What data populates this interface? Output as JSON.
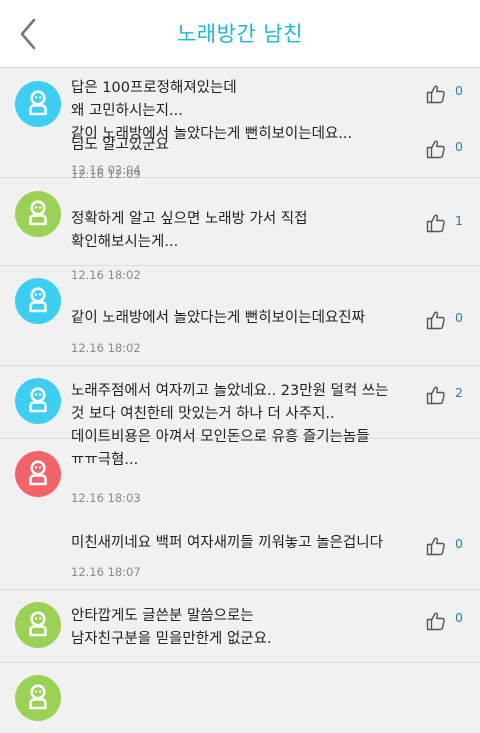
{
  "header": {
    "title": "노래방간 남친"
  },
  "colors": {
    "blue": "#3dcff2",
    "green": "#9bd155",
    "red": "#f2636a"
  },
  "comments": [
    {
      "avatar": "blue",
      "text": "답은 100프로정해져있는데\n왜 고민하시는지...\n같이 노래방에서 놀았다는게 뻔히보이는데요...",
      "time": "12.16 02:04",
      "likes": "0"
    },
    {
      "avatar": "green",
      "text": "님도 알고있군요",
      "time": "12.16 12:09",
      "likes": "0"
    },
    {
      "avatar": "blue",
      "text": "정확하게 알고 싶으면 노래방 가서 직접\n확인해보시는게...",
      "time": "12.16 18:02",
      "likes": "1"
    },
    {
      "avatar": "blue",
      "text": "같이 노래방에서 놀았다는게 뻔히보이는데요진짜",
      "time": "12.16 18:02",
      "likes": "0"
    },
    {
      "avatar": "red",
      "text": "노래주점에서 여자끼고 놀았네요.. 23만원 덜컥 쓰는\n것 보다 여친한테 맛있는거 하나 더 사주지..\n데이트비용은 아껴서 모인돈으로 유흥 즐기는놈들\nㅠㅠ극혐...",
      "time": "12.16 18:03",
      "likes": "2"
    },
    {
      "avatar": "green",
      "text": "미친새끼네요 백퍼 여자새끼들 끼워놓고 놀은겁니다",
      "time": "12.16 18:07",
      "likes": "0"
    },
    {
      "avatar": "green",
      "text": "안타깝게도 글쓴분 말씀으로는\n남자친구분을 믿을만한게 없군요.",
      "time": "",
      "likes": "0"
    }
  ]
}
